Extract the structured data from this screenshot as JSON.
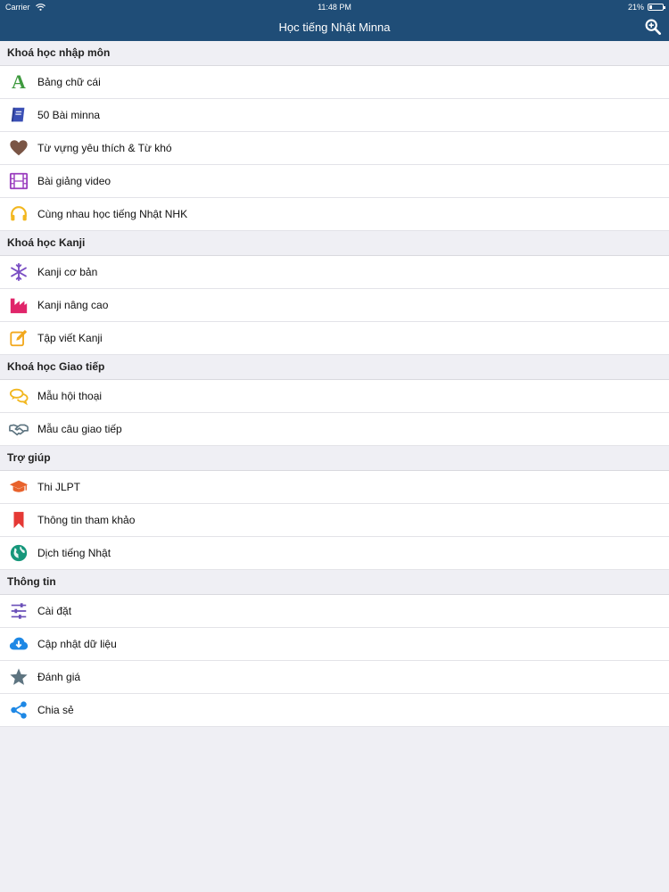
{
  "status": {
    "carrier": "Carrier",
    "time": "11:48 PM",
    "battery": "21%",
    "battery_level": 0.21
  },
  "nav": {
    "title": "Học tiếng Nhật Minna"
  },
  "sections": [
    {
      "title": "Khoá học nhập môn",
      "items": [
        {
          "label": "Bảng chữ cái",
          "glyph": "A"
        },
        {
          "label": "50 Bài minna"
        },
        {
          "label": "Từ vựng yêu thích & Từ khó"
        },
        {
          "label": "Bài giảng video"
        },
        {
          "label": "Cùng nhau học tiếng Nhật NHK"
        }
      ]
    },
    {
      "title": "Khoá học Kanji",
      "items": [
        {
          "label": "Kanji cơ bản"
        },
        {
          "label": "Kanji nâng cao"
        },
        {
          "label": "Tập viết Kanji"
        }
      ]
    },
    {
      "title": "Khoá học Giao tiếp",
      "items": [
        {
          "label": "Mẫu hội thoại"
        },
        {
          "label": "Mẫu câu giao tiếp"
        }
      ]
    },
    {
      "title": "Trợ giúp",
      "items": [
        {
          "label": "Thi JLPT"
        },
        {
          "label": "Thông tin tham khảo"
        },
        {
          "label": "Dịch tiếng Nhật"
        }
      ]
    },
    {
      "title": "Thông tin",
      "items": [
        {
          "label": "Cài đặt"
        },
        {
          "label": "Cập nhật dữ liệu"
        },
        {
          "label": "Đánh giá"
        },
        {
          "label": "Chia sẻ"
        }
      ]
    }
  ]
}
